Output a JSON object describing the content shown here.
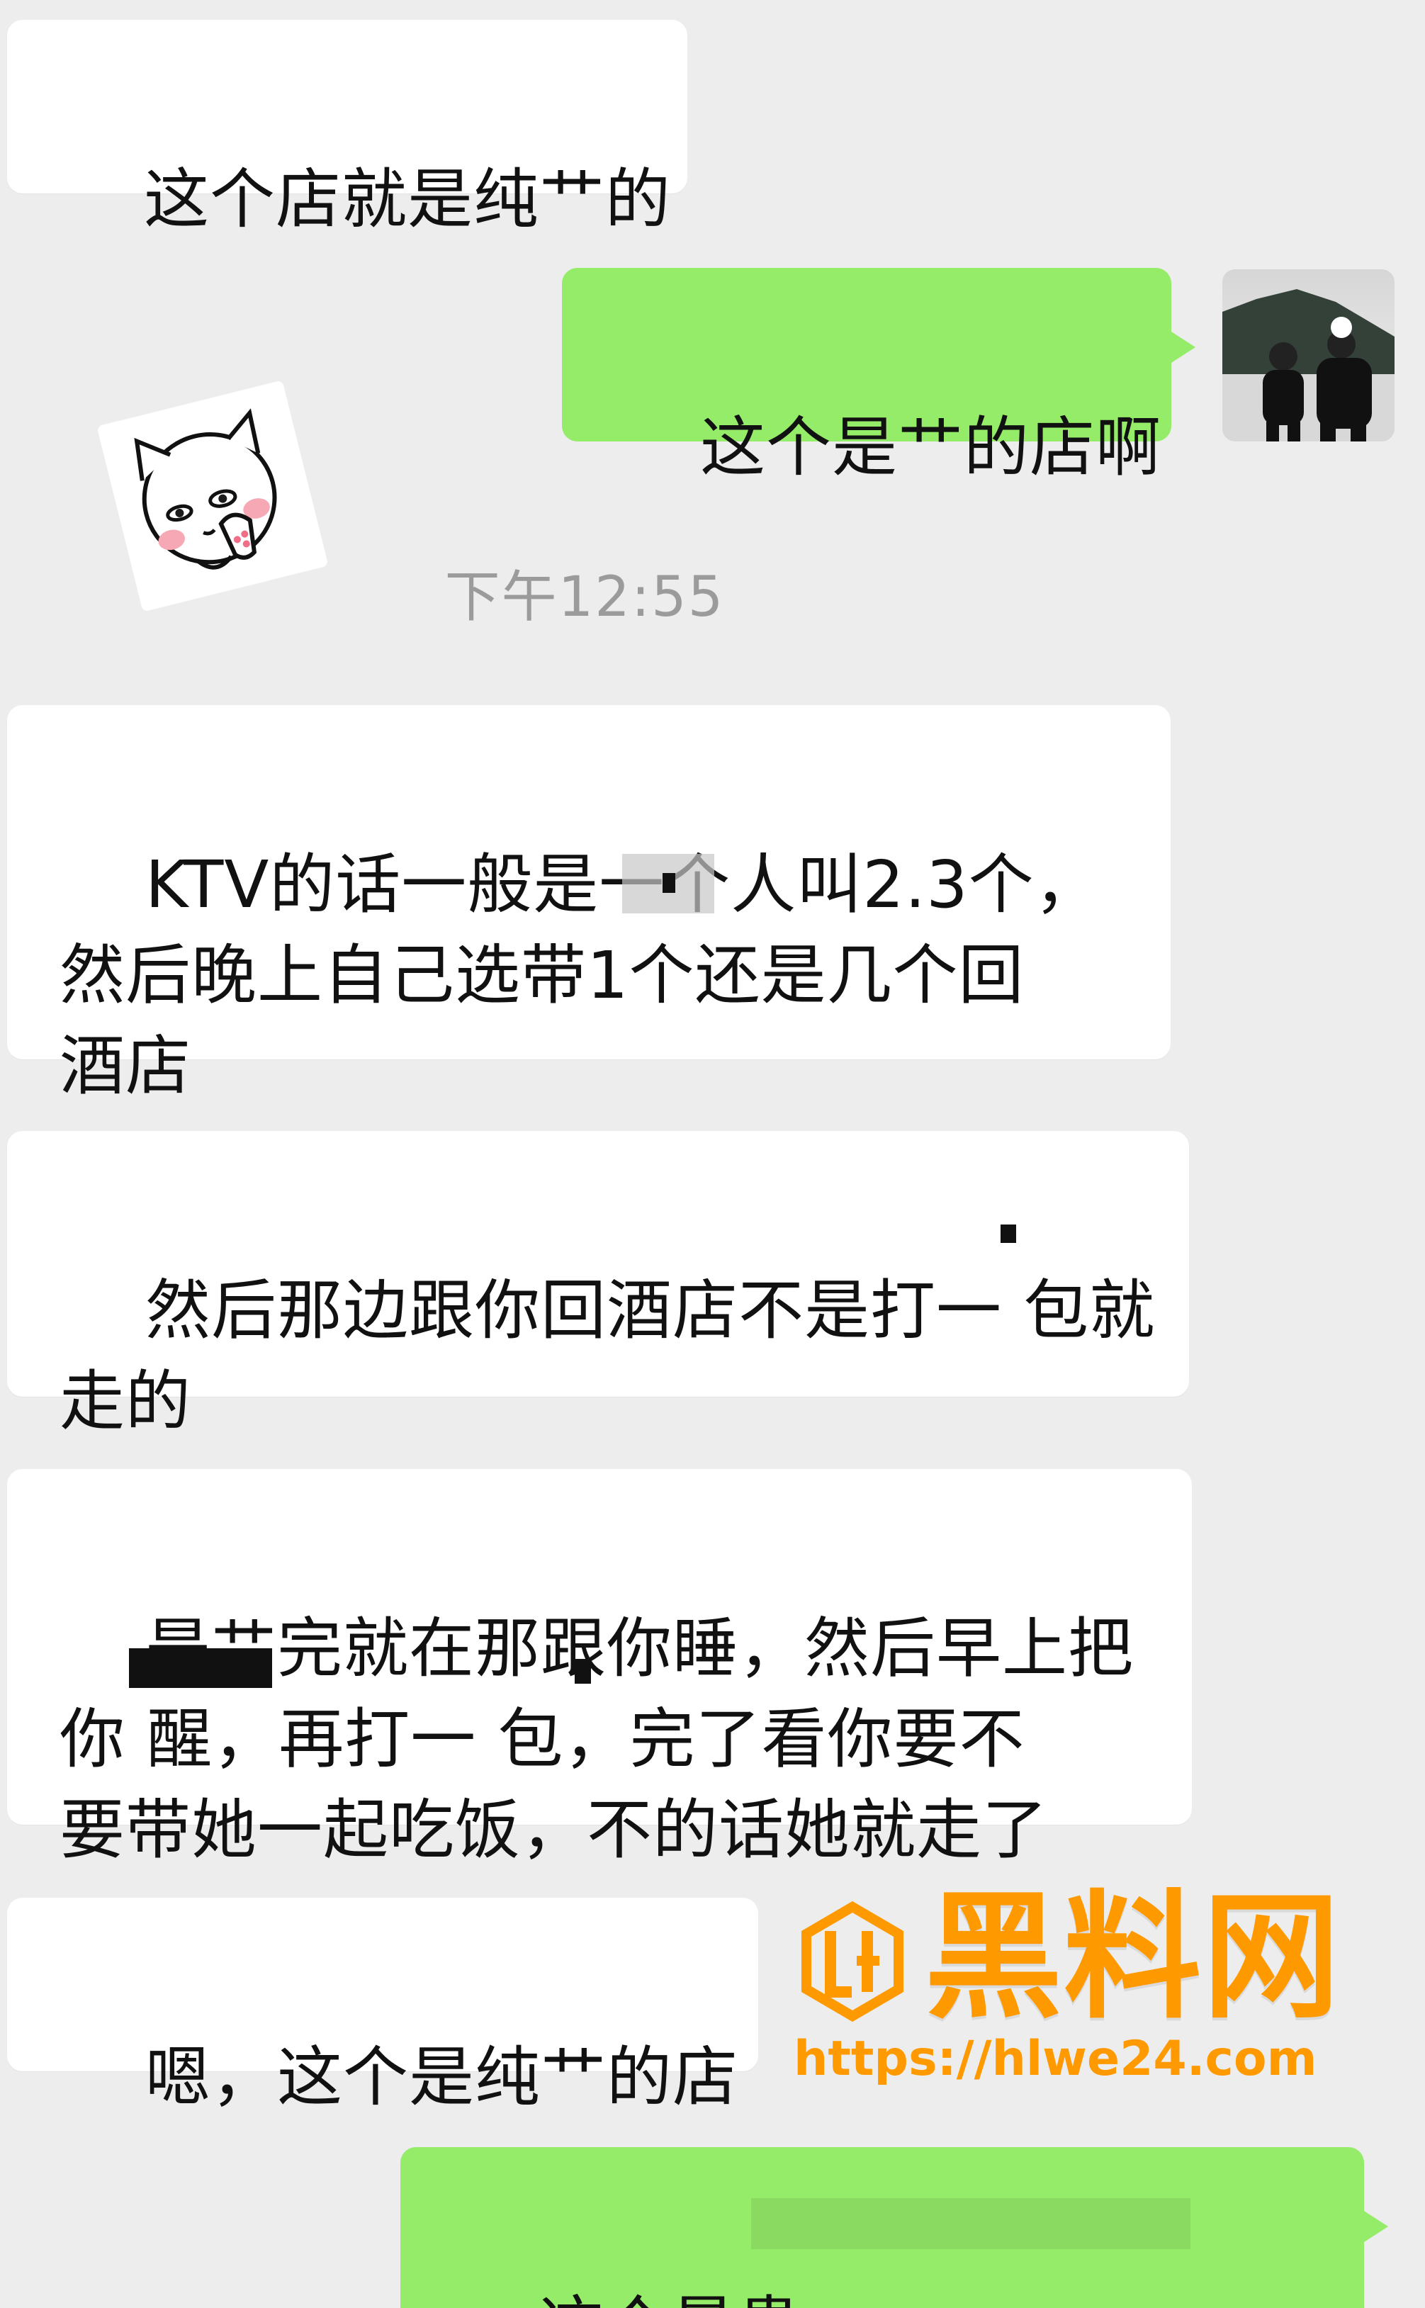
{
  "messages": [
    {
      "side": "left",
      "text": "这个店就是纯艹的"
    },
    {
      "side": "right",
      "text": "这个是艹的店啊"
    },
    {
      "side": "left",
      "text": "KTV的话一般是一个人叫2.3个，\n然后晚上自己选带1个还是几个回\n酒店"
    },
    {
      "side": "left",
      "text": "然后那边跟你回酒店不是打一 包就\n走的"
    },
    {
      "side": "left",
      "text": "是艹完就在那跟你睡，然后早上把\n你 醒，再打一 包，完了看你要不\n要带她一起吃饭，不的话她就走了"
    },
    {
      "side": "left",
      "text": "嗯，这个是纯艹的店"
    },
    {
      "side": "right",
      "text": "这个最贵"
    }
  ],
  "timestamp": "下午12:55",
  "watermark": {
    "title": "黑料网",
    "url": "https://hlwe24.com"
  },
  "colors": {
    "background": "#ededed",
    "left_bubble": "#ffffff",
    "right_bubble": "#95ec69",
    "watermark": "#ff9900"
  },
  "icons": {
    "sticker": "cat-sticker-icon",
    "avatar": "user-avatar-icon",
    "watermark_logo": "watermark-logo-icon"
  }
}
